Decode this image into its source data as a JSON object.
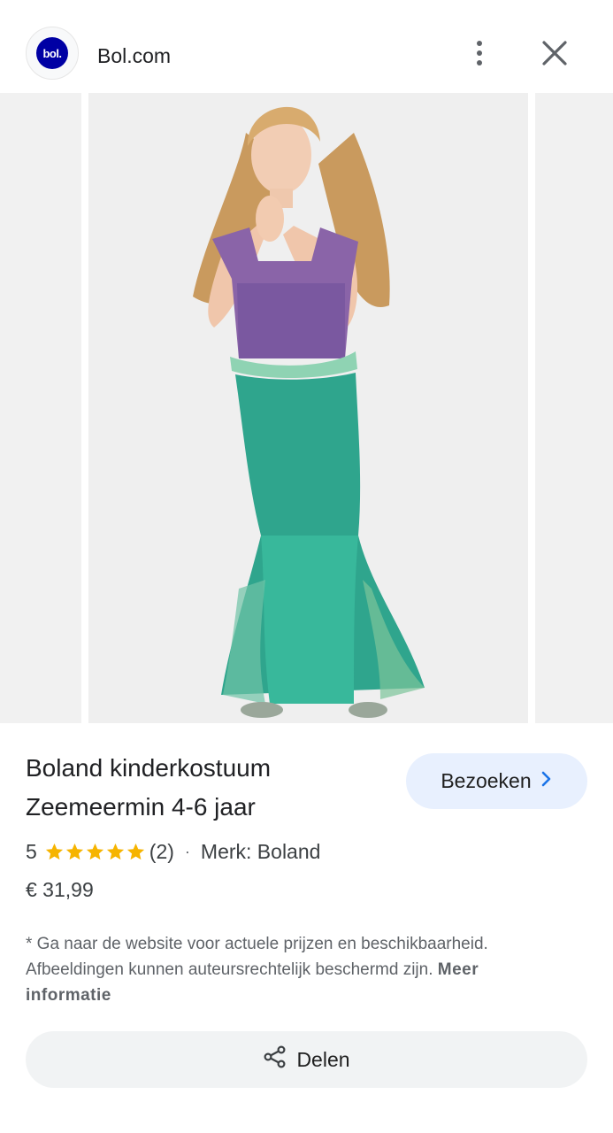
{
  "header": {
    "logo_text": "bol.",
    "site_name": "Bol.com"
  },
  "product": {
    "title": "Boland kinderkostuum Zeemeermin 4-6 jaar",
    "visit_label": "Bezoeken",
    "rating_value": "5",
    "rating_stars": 5,
    "review_count": "(2)",
    "separator": "·",
    "brand": "Merk: Boland",
    "price": "€ 31,99"
  },
  "disclaimer": {
    "text": "* Ga naar de website voor actuele prijzen en beschikbaarheid. Afbeeldingen kunnen auteursrechtelijk beschermd zijn.",
    "link_label": "Meer informatie"
  },
  "share": {
    "label": "Delen"
  },
  "colors": {
    "brand_blue": "#0000a4",
    "star": "#f6b400",
    "visit_bg": "#e8f0fe"
  },
  "icons": [
    "more-vert-icon",
    "close-icon",
    "chevron-right-icon",
    "share-icon",
    "star-icon"
  ]
}
